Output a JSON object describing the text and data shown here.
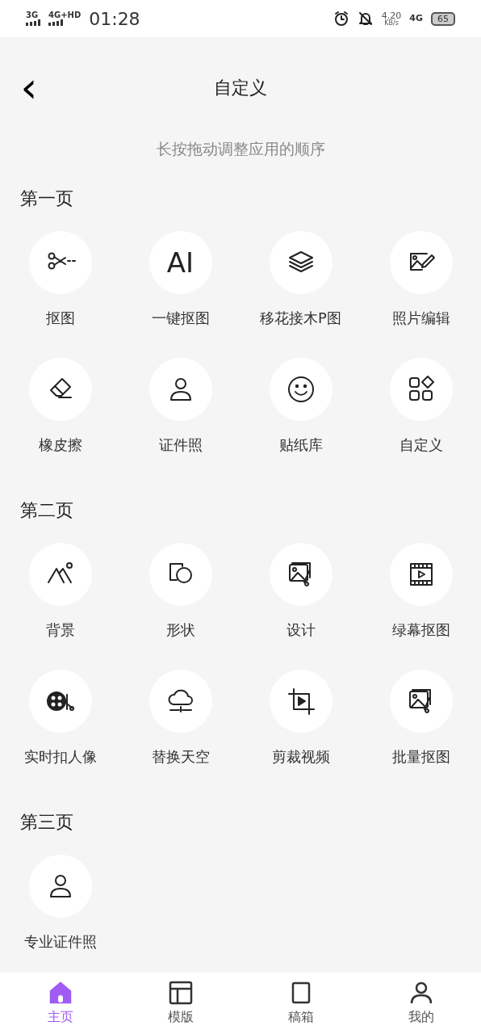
{
  "status_bar": {
    "networks": [
      "3G",
      "4G+HD"
    ],
    "time": "01:28",
    "speed": "4.20",
    "speed_unit": "KB/s",
    "network_right": "4G",
    "battery": "65"
  },
  "header": {
    "back": "‹",
    "title": "自定义"
  },
  "hint": "长按拖动调整应用的顺序",
  "sections": [
    {
      "title": "第一页",
      "items": [
        {
          "label": "抠图"
        },
        {
          "label": "一键抠图",
          "icon_text": "AI"
        },
        {
          "label": "移花接木P图"
        },
        {
          "label": "照片编辑"
        },
        {
          "label": "橡皮擦"
        },
        {
          "label": "证件照"
        },
        {
          "label": "贴纸库"
        },
        {
          "label": "自定义"
        }
      ]
    },
    {
      "title": "第二页",
      "items": [
        {
          "label": "背景"
        },
        {
          "label": "形状"
        },
        {
          "label": "设计"
        },
        {
          "label": "绿幕抠图"
        },
        {
          "label": "实时扣人像"
        },
        {
          "label": "替换天空"
        },
        {
          "label": "剪裁视频"
        },
        {
          "label": "批量抠图"
        }
      ]
    },
    {
      "title": "第三页",
      "items": [
        {
          "label": "专业证件照"
        }
      ]
    }
  ],
  "bottom_nav": [
    {
      "label": "主页",
      "selected": true
    },
    {
      "label": "模版",
      "selected": false
    },
    {
      "label": "稿箱",
      "selected": false
    },
    {
      "label": "我的",
      "selected": false
    }
  ]
}
